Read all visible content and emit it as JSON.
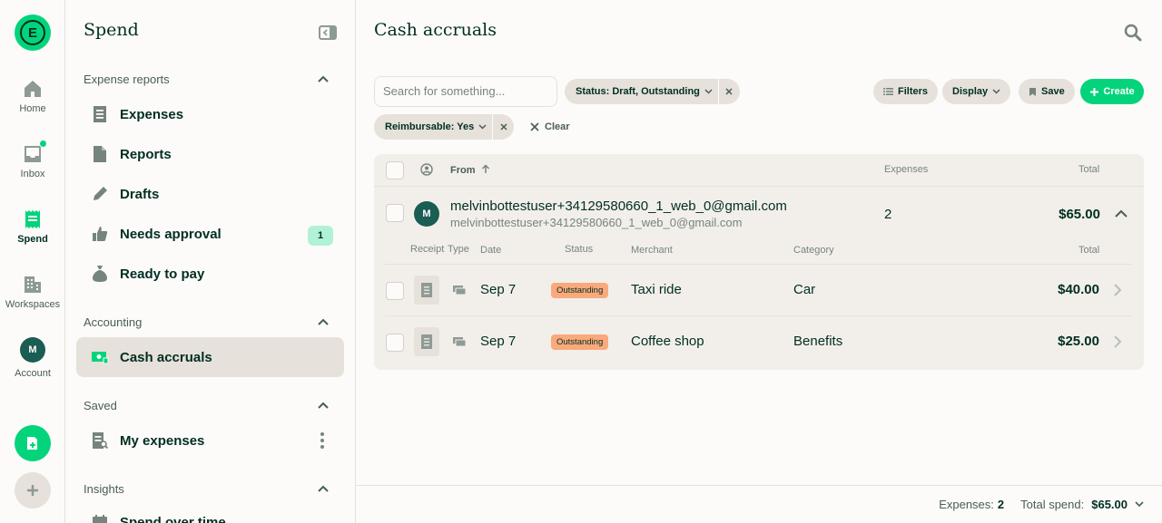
{
  "rail": {
    "logo_letter": "E",
    "items": [
      {
        "label": "Home"
      },
      {
        "label": "Inbox"
      },
      {
        "label": "Spend"
      },
      {
        "label": "Workspaces"
      },
      {
        "label": "Account",
        "avatar": "M"
      }
    ]
  },
  "sidebar": {
    "title": "Spend",
    "sections": {
      "expense_reports": {
        "heading": "Expense reports",
        "items": [
          {
            "label": "Expenses",
            "icon": "receipt-icon"
          },
          {
            "label": "Reports",
            "icon": "document-icon"
          },
          {
            "label": "Drafts",
            "icon": "pencil-icon"
          },
          {
            "label": "Needs approval",
            "icon": "thumbs-up-icon",
            "count": "1"
          },
          {
            "label": "Ready to pay",
            "icon": "money-bag-icon"
          }
        ]
      },
      "accounting": {
        "heading": "Accounting",
        "items": [
          {
            "label": "Cash accruals",
            "icon": "cash-icon"
          }
        ]
      },
      "saved": {
        "heading": "Saved",
        "items": [
          {
            "label": "My expenses",
            "icon": "receipt-search-icon"
          }
        ]
      },
      "insights": {
        "heading": "Insights",
        "items": [
          {
            "label": "Spend over time",
            "icon": "calendar-icon"
          }
        ]
      }
    }
  },
  "main": {
    "title": "Cash accruals",
    "search_placeholder": "Search for something...",
    "filters": {
      "status": "Status: Draft, Outstanding",
      "reimbursable": "Reimbursable: Yes",
      "clear": "Clear"
    },
    "actions": {
      "filters": "Filters",
      "display": "Display",
      "save": "Save",
      "create": "Create"
    },
    "table": {
      "headers": {
        "from": "From",
        "expenses": "Expenses",
        "total": "Total"
      },
      "group": {
        "avatar": "M",
        "email": "melvinbottestuser+34129580660_1_web_0@gmail.com",
        "sub": "melvinbottestuser+34129580660_1_web_0@gmail.com",
        "count": "2",
        "total": "$65.00"
      },
      "sub_headers": {
        "receipt": "Receipt",
        "type": "Type",
        "date": "Date",
        "status": "Status",
        "merchant": "Merchant",
        "category": "Category",
        "total": "Total"
      },
      "rows": [
        {
          "date": "Sep 7",
          "status": "Outstanding",
          "merchant": "Taxi ride",
          "category": "Car",
          "amount": "$40.00"
        },
        {
          "date": "Sep 7",
          "status": "Outstanding",
          "merchant": "Coffee shop",
          "category": "Benefits",
          "amount": "$25.00"
        }
      ]
    }
  },
  "footer": {
    "expenses_label": "Expenses:",
    "expenses_value": "2",
    "spend_label": "Total spend:",
    "spend_value": "$65.00"
  },
  "colors": {
    "brand_green": "#03d47c",
    "dark_green": "#002e22",
    "status_outstanding": "#f9a97b",
    "count_badge": "#b1f2d6"
  }
}
